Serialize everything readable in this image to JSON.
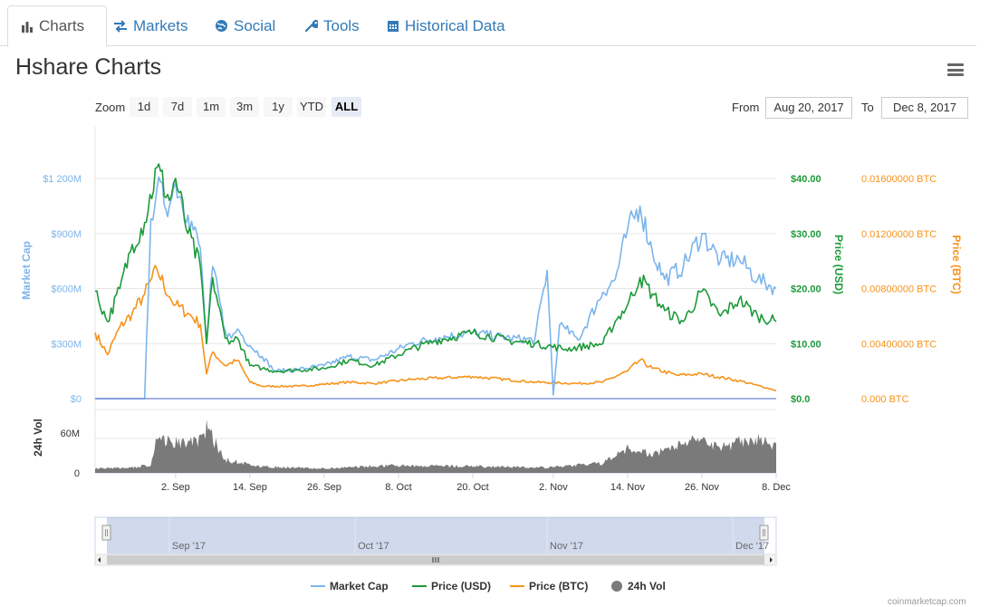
{
  "tabs": [
    {
      "label": "Charts",
      "icon": "bar-chart-icon",
      "active": true
    },
    {
      "label": "Markets",
      "icon": "exchange-icon",
      "active": false
    },
    {
      "label": "Social",
      "icon": "globe-icon",
      "active": false
    },
    {
      "label": "Tools",
      "icon": "wrench-icon",
      "active": false
    },
    {
      "label": "Historical Data",
      "icon": "calendar-icon",
      "active": false
    }
  ],
  "page_title": "Hshare Charts",
  "toolbar": {
    "zoom_label": "Zoom",
    "zoom_buttons": [
      "1d",
      "7d",
      "1m",
      "3m",
      "1y",
      "YTD",
      "ALL"
    ],
    "selected_zoom": "ALL",
    "from_label": "From",
    "from_date": "Aug 20, 2017",
    "to_label": "To",
    "to_date": "Dec 8, 2017"
  },
  "colors": {
    "market_cap": "#7cb5ec",
    "price_usd": "#1c9a3a",
    "price_btc": "#f7931a",
    "volume": "#7a7a7a",
    "navigator": "#4a67c9"
  },
  "footer": "coinmarketcap.com",
  "chart_data": {
    "type": "line",
    "x_tick_labels": [
      "2. Sep",
      "14. Sep",
      "26. Sep",
      "8. Oct",
      "20. Oct",
      "2. Nov",
      "14. Nov",
      "26. Nov",
      "8. Dec"
    ],
    "x_range": [
      "2017-08-20",
      "2017-12-08"
    ],
    "axes": {
      "market_cap": {
        "title": "Market Cap",
        "ticks": [
          "$0",
          "$300M",
          "$600M",
          "$900M",
          "$1 200M"
        ],
        "ylim": [
          0,
          1200
        ],
        "unit": "M USD",
        "side": "left"
      },
      "price_usd": {
        "title": "Price (USD)",
        "ticks": [
          "$0.0",
          "$10.00",
          "$20.00",
          "$30.00",
          "$40.00"
        ],
        "ylim": [
          0,
          40
        ],
        "side": "right"
      },
      "price_btc": {
        "title": "Price (BTC)",
        "ticks": [
          "0.000 BTC",
          "0.00400000 BTC",
          "0.00800000 BTC",
          "0.01200000 BTC",
          "0.01600000 BTC"
        ],
        "ylim": [
          0,
          0.016
        ],
        "side": "right"
      },
      "volume": {
        "title": "24h Vol",
        "ticks": [
          "0",
          "60M"
        ],
        "ylim": [
          0,
          90
        ],
        "unit": "M USD"
      }
    },
    "series": [
      {
        "name": "Market Cap",
        "axis": "market_cap",
        "x": [
          "2017-08-20",
          "2017-08-28",
          "2017-08-29",
          "2017-08-30",
          "2017-09-01",
          "2017-09-02",
          "2017-09-04",
          "2017-09-06",
          "2017-09-07",
          "2017-09-08",
          "2017-09-10",
          "2017-09-11",
          "2017-09-12",
          "2017-09-14",
          "2017-09-16",
          "2017-09-18",
          "2017-09-22",
          "2017-09-26",
          "2017-09-30",
          "2017-10-04",
          "2017-10-10",
          "2017-10-14",
          "2017-10-20",
          "2017-10-26",
          "2017-10-30",
          "2017-11-01",
          "2017-11-02",
          "2017-11-03",
          "2017-11-04",
          "2017-11-06",
          "2017-11-10",
          "2017-11-12",
          "2017-11-14",
          "2017-11-16",
          "2017-11-18",
          "2017-11-20",
          "2017-11-23",
          "2017-11-26",
          "2017-11-29",
          "2017-12-02",
          "2017-12-05",
          "2017-12-08"
        ],
        "values": [
          0,
          0,
          980,
          1150,
          1050,
          1180,
          1000,
          820,
          300,
          720,
          370,
          330,
          380,
          290,
          230,
          150,
          160,
          180,
          230,
          210,
          300,
          330,
          360,
          330,
          320,
          700,
          20,
          400,
          380,
          320,
          580,
          650,
          920,
          1050,
          800,
          650,
          720,
          900,
          750,
          760,
          650,
          600
        ]
      },
      {
        "name": "Price (USD)",
        "axis": "price_usd",
        "x": [
          "2017-08-20",
          "2017-08-22",
          "2017-08-24",
          "2017-08-26",
          "2017-08-28",
          "2017-08-30",
          "2017-09-01",
          "2017-09-02",
          "2017-09-04",
          "2017-09-06",
          "2017-09-07",
          "2017-09-08",
          "2017-09-10",
          "2017-09-11",
          "2017-09-12",
          "2017-09-14",
          "2017-09-16",
          "2017-09-18",
          "2017-09-22",
          "2017-09-26",
          "2017-09-30",
          "2017-10-04",
          "2017-10-10",
          "2017-10-14",
          "2017-10-20",
          "2017-10-26",
          "2017-10-30",
          "2017-11-04",
          "2017-11-10",
          "2017-11-12",
          "2017-11-14",
          "2017-11-16",
          "2017-11-18",
          "2017-11-20",
          "2017-11-23",
          "2017-11-26",
          "2017-11-29",
          "2017-12-02",
          "2017-12-05",
          "2017-12-08"
        ],
        "values": [
          19.5,
          14,
          20,
          28,
          32,
          42,
          36,
          40,
          30,
          24,
          10,
          22,
          11,
          10.5,
          11,
          6,
          5.5,
          5,
          5.2,
          5.5,
          7,
          6,
          9,
          10.5,
          12,
          10.5,
          10,
          9,
          10,
          14,
          17,
          22,
          19,
          16,
          14,
          19.5,
          15,
          18,
          15,
          14
        ]
      },
      {
        "name": "Price (BTC)",
        "axis": "price_btc",
        "x": [
          "2017-08-20",
          "2017-08-22",
          "2017-08-24",
          "2017-08-26",
          "2017-08-28",
          "2017-08-30",
          "2017-09-01",
          "2017-09-02",
          "2017-09-04",
          "2017-09-06",
          "2017-09-07",
          "2017-09-08",
          "2017-09-10",
          "2017-09-12",
          "2017-09-14",
          "2017-09-16",
          "2017-09-22",
          "2017-09-30",
          "2017-10-04",
          "2017-10-10",
          "2017-10-20",
          "2017-10-30",
          "2017-11-06",
          "2017-11-10",
          "2017-11-14",
          "2017-11-16",
          "2017-11-18",
          "2017-11-22",
          "2017-11-26",
          "2017-12-02",
          "2017-12-08"
        ],
        "values": [
          0.0048,
          0.0032,
          0.0052,
          0.0062,
          0.0076,
          0.0094,
          0.0074,
          0.0068,
          0.0062,
          0.0054,
          0.0018,
          0.0034,
          0.0024,
          0.0028,
          0.0012,
          0.0009,
          0.0009,
          0.0012,
          0.0011,
          0.0014,
          0.0016,
          0.0012,
          0.0011,
          0.0012,
          0.002,
          0.0028,
          0.0022,
          0.0017,
          0.0018,
          0.0013,
          0.0006
        ]
      },
      {
        "name": "24h Vol",
        "axis": "volume",
        "type": "area",
        "x": [
          "2017-08-20",
          "2017-08-26",
          "2017-08-29",
          "2017-08-30",
          "2017-09-03",
          "2017-09-06",
          "2017-09-07",
          "2017-09-10",
          "2017-09-16",
          "2017-09-26",
          "2017-10-06",
          "2017-10-20",
          "2017-11-01",
          "2017-11-10",
          "2017-11-14",
          "2017-11-18",
          "2017-11-24",
          "2017-11-30",
          "2017-12-04",
          "2017-12-08"
        ],
        "values": [
          8,
          10,
          15,
          65,
          55,
          60,
          85,
          25,
          12,
          8,
          14,
          12,
          10,
          18,
          45,
          35,
          60,
          50,
          65,
          50
        ]
      }
    ],
    "grid": true,
    "legend": "bottom-center",
    "navigator_labels": [
      "Sep '17",
      "Oct '17",
      "Nov '17",
      "Dec '17"
    ]
  }
}
